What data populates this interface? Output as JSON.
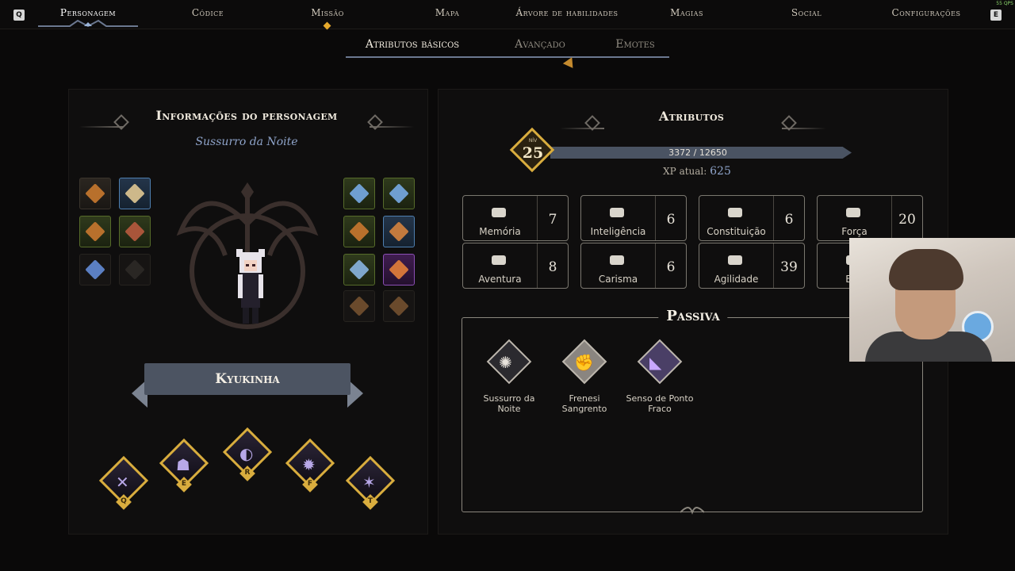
{
  "topnav": {
    "left_key": "Q",
    "right_key": "E",
    "items": [
      {
        "label": "Personagem",
        "active": true
      },
      {
        "label": "Códice"
      },
      {
        "label": "Missão"
      },
      {
        "label": "Mapa"
      },
      {
        "label": "Árvore de habilidades"
      },
      {
        "label": "Magias"
      },
      {
        "label": "Social"
      },
      {
        "label": "Configurações"
      }
    ],
    "fps": "55 QPS"
  },
  "subtabs": [
    {
      "label": "Atributos básicos",
      "active": true
    },
    {
      "label": "Avançado"
    },
    {
      "label": "Emotes"
    }
  ],
  "left_panel": {
    "title": "Informações do personagem",
    "subtitle": "Sussurro da Noite",
    "character_name": "Kyukinha",
    "abilities": [
      {
        "key": "Q",
        "icon": "crossed-blades-icon"
      },
      {
        "key": "E",
        "icon": "hooded-figure-icon"
      },
      {
        "key": "R",
        "icon": "moon-orb-icon"
      },
      {
        "key": "F",
        "icon": "shadow-burst-icon"
      },
      {
        "key": "T",
        "icon": "claw-slash-icon"
      }
    ]
  },
  "right_panel": {
    "title": "Atributos",
    "level_label": "NÍV",
    "level": "25",
    "xp_text": "3372 / 12650",
    "xp_current_label": "XP atual:",
    "xp_current_value": "625",
    "xp_progress": 0.2666,
    "attributes": [
      {
        "label": "Memória",
        "value": "7"
      },
      {
        "label": "Inteligência",
        "value": "6"
      },
      {
        "label": "Constituição",
        "value": "6"
      },
      {
        "label": "Força",
        "value": "20"
      },
      {
        "label": "Aventura",
        "value": "8"
      },
      {
        "label": "Carisma",
        "value": "6"
      },
      {
        "label": "Agilidade",
        "value": "39"
      },
      {
        "label": "Ene",
        "value": ""
      }
    ],
    "passive_title": "Passiva",
    "passives": [
      {
        "label": "Sussurro da Noite",
        "icon": "night-whisper-icon"
      },
      {
        "label": "Frenesi Sangrento",
        "icon": "blood-frenzy-icon"
      },
      {
        "label": "Senso de Ponto Fraco",
        "icon": "weak-point-icon"
      }
    ]
  },
  "colors": {
    "accent_gold": "#d9ad3e",
    "subtitle_blue": "#8ea3c9",
    "xp_bar": "#4a5362"
  }
}
